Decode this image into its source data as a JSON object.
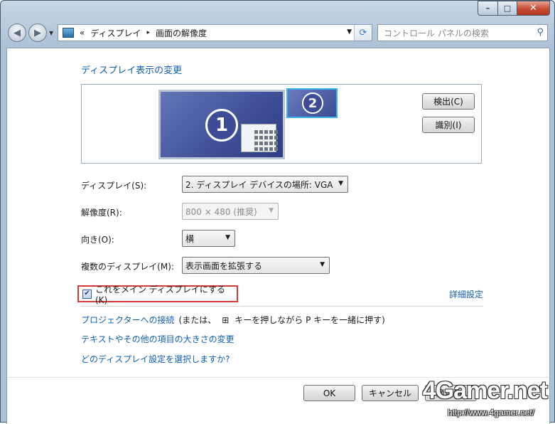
{
  "window": {
    "caption_min": "–",
    "caption_max": "□",
    "caption_close": "✕"
  },
  "nav": {
    "back_icon": "arrow-left-icon",
    "forward_icon": "arrow-right-icon",
    "breadcrumb": [
      "«",
      "ディスプレイ",
      "画面の解像度"
    ],
    "breadcrumb_sep": "▸",
    "search_placeholder": "コントロール パネルの検索"
  },
  "page": {
    "heading": "ディスプレイ表示の変更",
    "detect_button": "検出(C)",
    "identify_button": "識別(I)",
    "monitor1_number": "1",
    "monitor2_number": "2"
  },
  "settings": {
    "display_label": "ディスプレイ(S):",
    "display_value": "2. ディスプレイ デバイスの場所: VGA",
    "resolution_label": "解像度(R):",
    "resolution_value": "800 × 480 (推奨)",
    "orientation_label": "向き(O):",
    "orientation_value": "横",
    "multiple_label": "複数のディスプレイ(M):",
    "multiple_value": "表示画面を拡張する"
  },
  "options": {
    "main_display_checkbox": "これをメイン ディスプレイにする(K)",
    "main_display_checked": true,
    "advanced_link": "詳細設定"
  },
  "links": {
    "projector_link": "プロジェクターへの接続",
    "projector_note_1": "(または、",
    "projector_note_2": "キーを押しながら P キーを一緒に押す)",
    "text_size_link": "テキストやその他の項目の大きさの変更",
    "which_settings_link": "どのディスプレイ設定を選択しますか?"
  },
  "footer": {
    "ok_button": "OK",
    "cancel_button": "キャンセル",
    "apply_button": "適用(A)"
  },
  "watermark": {
    "logo": "4Gamer.net",
    "url": "http://www.4gamer.net/"
  }
}
